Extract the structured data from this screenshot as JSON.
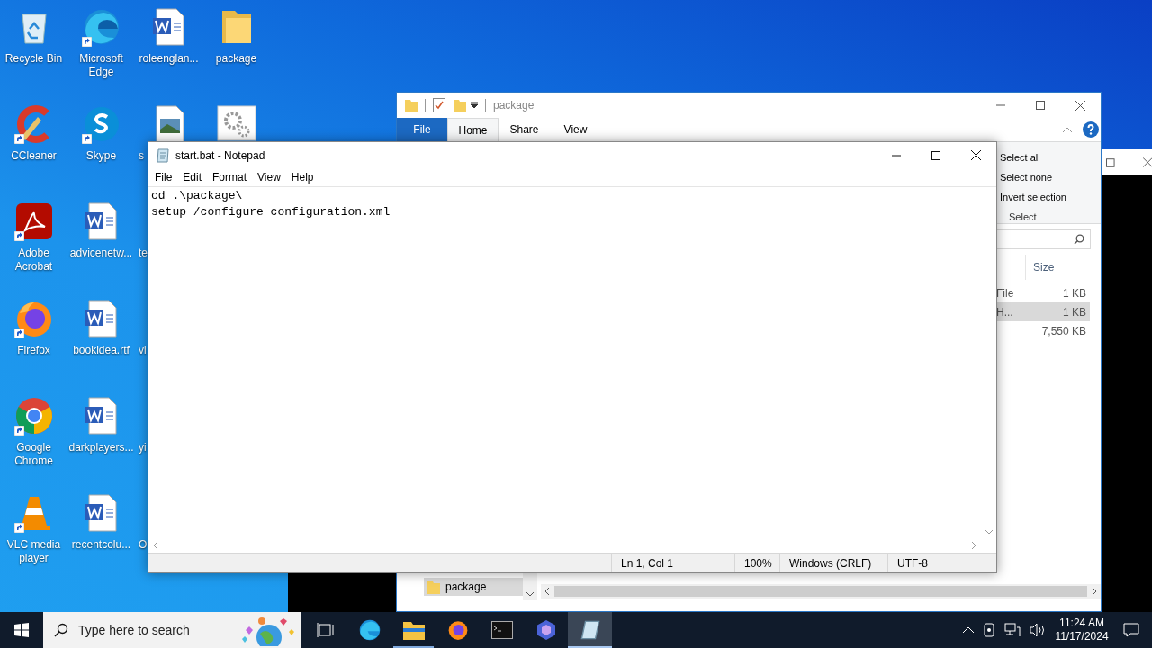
{
  "desktop": {
    "columns": [
      [
        {
          "label": "Recycle Bin",
          "kind": "recycle",
          "shortcut": false,
          "cut": false
        },
        {
          "label": "CCleaner",
          "kind": "ccleaner",
          "shortcut": true,
          "cut": false
        },
        {
          "label": "Adobe Acrobat",
          "kind": "acrobat",
          "shortcut": true,
          "cut": false
        },
        {
          "label": "Firefox",
          "kind": "firefox",
          "shortcut": true,
          "cut": false
        },
        {
          "label": "Google Chrome",
          "kind": "chrome",
          "shortcut": true,
          "cut": false
        },
        {
          "label": "VLC media player",
          "kind": "vlc",
          "shortcut": true,
          "cut": false
        }
      ],
      [
        {
          "label": "Microsoft Edge",
          "kind": "edge",
          "shortcut": true,
          "cut": false
        },
        {
          "label": "Skype",
          "kind": "skype",
          "shortcut": true,
          "cut": false
        },
        {
          "label": "advicenetw...",
          "kind": "word",
          "shortcut": false,
          "cut": false
        },
        {
          "label": "bookidea.rtf",
          "kind": "word",
          "shortcut": false,
          "cut": false
        },
        {
          "label": "darkplayers...",
          "kind": "word",
          "shortcut": false,
          "cut": false
        },
        {
          "label": "recentcolu...",
          "kind": "word",
          "shortcut": false,
          "cut": false
        }
      ],
      [
        {
          "label": "roleenglan...",
          "kind": "word",
          "shortcut": false,
          "cut": false
        },
        {
          "label": "s",
          "kind": "image",
          "shortcut": false,
          "cut": true
        },
        {
          "label": "te",
          "kind": "hidden",
          "shortcut": false,
          "cut": true
        },
        {
          "label": "vi",
          "kind": "hidden",
          "shortcut": false,
          "cut": true
        },
        {
          "label": "yi",
          "kind": "hidden",
          "shortcut": false,
          "cut": true
        },
        {
          "label": "O",
          "kind": "hidden",
          "shortcut": false,
          "cut": true
        }
      ],
      [
        {
          "label": "package",
          "kind": "folder",
          "shortcut": false,
          "cut": false
        },
        {
          "kind": "settings",
          "shortcut": false
        }
      ]
    ]
  },
  "explorer": {
    "title": "package",
    "tabs": [
      {
        "label": "File",
        "kind": "file",
        "selected": false
      },
      {
        "label": "Home",
        "kind": "tab",
        "selected": true
      },
      {
        "label": "Share",
        "kind": "tab",
        "selected": false
      },
      {
        "label": "View",
        "kind": "tab",
        "selected": false
      }
    ],
    "select_group": {
      "items": [
        "Select all",
        "Select none",
        "Invert selection"
      ],
      "label": "Select"
    },
    "columns": [
      "Size"
    ],
    "rows": [
      {
        "type": "File",
        "size": "1 KB",
        "selected": false
      },
      {
        "type": "H...",
        "size": "1 KB",
        "selected": true
      },
      {
        "size": "7,550 KB",
        "selected": false
      }
    ],
    "nav_items": [
      {
        "label": "package",
        "selected": true
      }
    ]
  },
  "notepad": {
    "title": "start.bat - Notepad",
    "menu": [
      "File",
      "Edit",
      "Format",
      "View",
      "Help"
    ],
    "lines": [
      "cd .\\package\\",
      "setup /configure configuration.xml"
    ],
    "status": [
      "Ln 1, Col 1",
      "100%",
      "Windows (CRLF)",
      "UTF-8"
    ]
  },
  "taskbar": {
    "search_placeholder": "Type here to search",
    "apps": [
      {
        "kind": "taskview",
        "active": false,
        "open": false
      },
      {
        "kind": "edge",
        "active": false,
        "open": false
      },
      {
        "kind": "explorer",
        "active": false,
        "open": true
      },
      {
        "kind": "firefox",
        "active": false,
        "open": false
      },
      {
        "kind": "terminal",
        "active": false,
        "open": false
      },
      {
        "kind": "copilot",
        "active": false,
        "open": false
      },
      {
        "kind": "notepad",
        "active": true,
        "open": true
      }
    ],
    "time": "11:24 AM",
    "date": "11/17/2024"
  }
}
